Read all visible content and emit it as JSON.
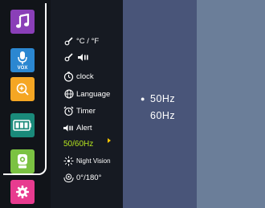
{
  "menu": {
    "items": [
      {
        "label": "°C / °F",
        "icon": "thermometer-icon"
      },
      {
        "label": "◀▮▮",
        "icon": "thermometer-sound-icon"
      },
      {
        "label": "clock",
        "icon": "clock-icon"
      },
      {
        "label": "Language",
        "icon": "globe-icon"
      },
      {
        "label": "Timer",
        "icon": "alarm-icon"
      },
      {
        "label": "Alert",
        "icon": "speaker-icon"
      },
      {
        "label": "50/60Hz",
        "icon": "frequency-icon"
      },
      {
        "label": "Night Vision",
        "icon": "night-vision-icon"
      },
      {
        "label": "0°/180°",
        "icon": "rotate-camera-icon"
      }
    ]
  },
  "options": {
    "items": [
      {
        "label": "50Hz",
        "selected": true
      },
      {
        "label": "60Hz",
        "selected": false
      }
    ]
  },
  "sidebar": {
    "vox_label": "VOX"
  },
  "colors": {
    "active": "#b6e51f",
    "arrow": "#f5c400",
    "option_panel": "#495579"
  }
}
